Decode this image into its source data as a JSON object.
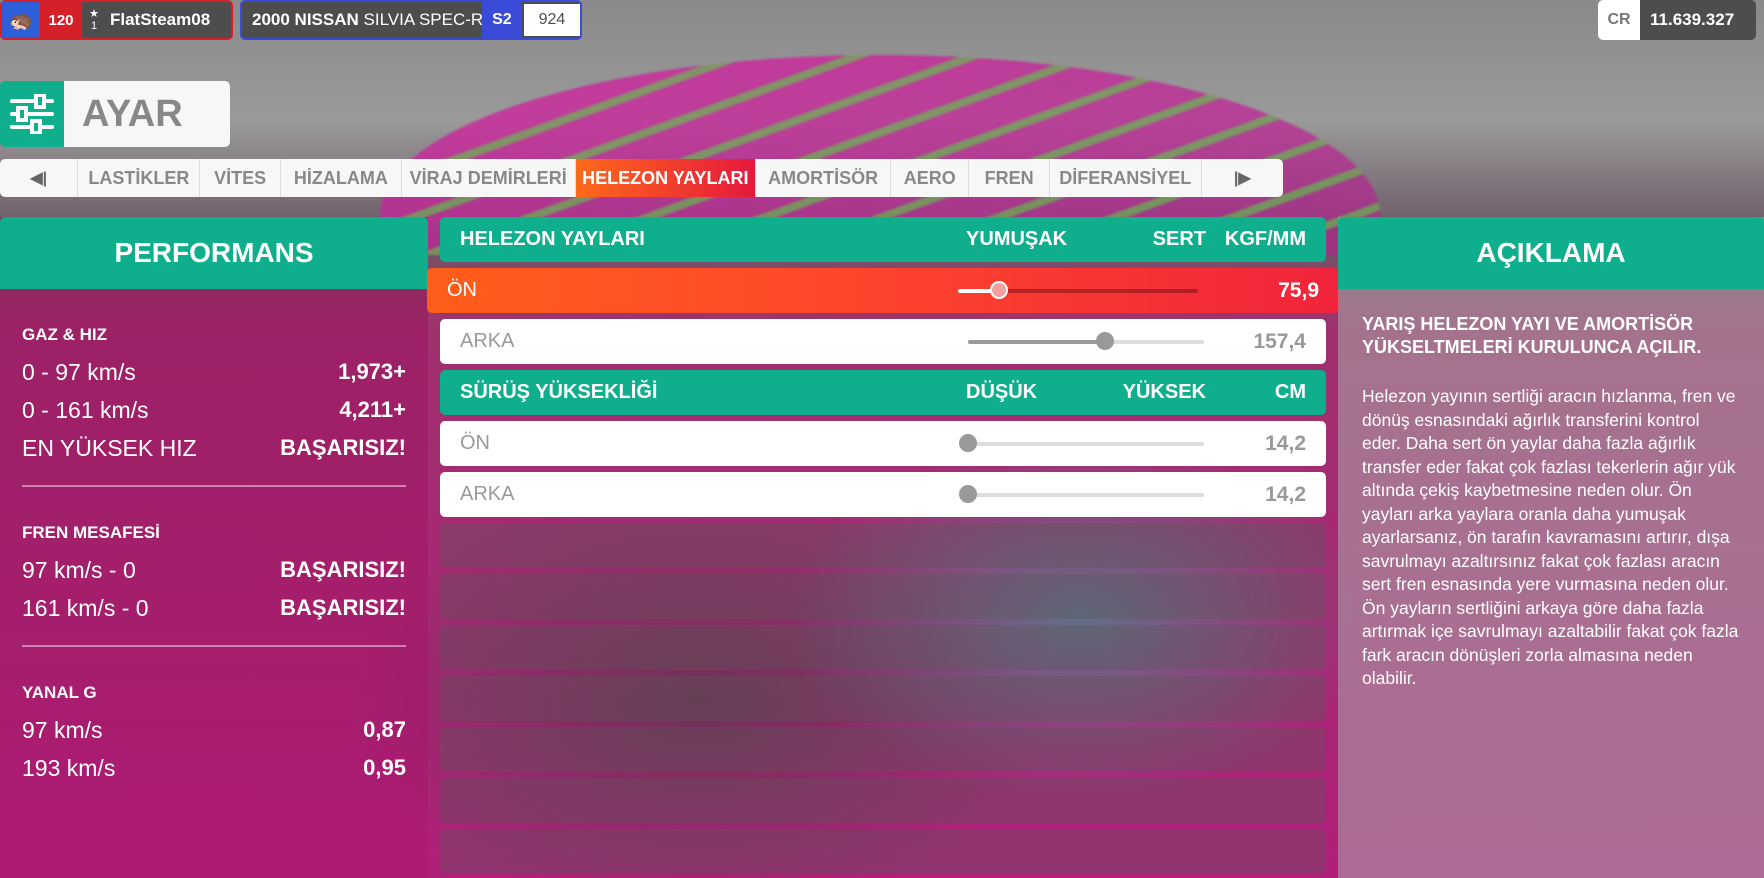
{
  "player": {
    "level": "120",
    "rank": "1",
    "gamertag": "FlatSteam08"
  },
  "car": {
    "name_bold": "2000 NISSAN",
    "name_rest": "SILVIA SPEC-R",
    "class": "S2",
    "pi": "924"
  },
  "credits": {
    "label": "CR",
    "amount": "11.639.327"
  },
  "page_title": "AYAR",
  "tabs": {
    "prev_icon": "◀|",
    "next_icon": "|▶",
    "items": [
      "LASTİKLER",
      "VİTES",
      "HİZALAMA",
      "VİRAJ DEMİRLERİ",
      "HELEZON YAYLARI",
      "AMORTİSÖR",
      "AERO",
      "FREN",
      "DİFERANSİYEL"
    ],
    "active": "HELEZON YAYLARI"
  },
  "performance": {
    "header": "PERFORMANS",
    "sections": [
      {
        "title": "GAZ & HIZ",
        "rows": [
          {
            "label": "0 - 97 km/s",
            "value": "1,973+"
          },
          {
            "label": "0 - 161 km/s",
            "value": "4,211+"
          },
          {
            "label": "EN YÜKSEK HIZ",
            "value": "BAŞARISIZ!"
          }
        ]
      },
      {
        "title": "FREN MESAFESİ",
        "rows": [
          {
            "label": "97 km/s - 0",
            "value": "BAŞARISIZ!"
          },
          {
            "label": "161 km/s - 0",
            "value": "BAŞARISIZ!"
          }
        ]
      },
      {
        "title": "YANAL G",
        "rows": [
          {
            "label": "97 km/s",
            "value": "0,87"
          },
          {
            "label": "193 km/s",
            "value": "0,95"
          }
        ]
      }
    ]
  },
  "springs": {
    "title": "HELEZON YAYLARI",
    "low": "YUMUŞAK",
    "high": "SERT",
    "unit": "KGF/MM",
    "rows": [
      {
        "label": "ÖN",
        "value": "75,9",
        "fraction": 0.17
      },
      {
        "label": "ARKA",
        "value": "157,4",
        "fraction": 0.58
      }
    ]
  },
  "ride_height": {
    "title": "SÜRÜŞ YÜKSEKLİĞİ",
    "low": "DÜŞÜK",
    "high": "YÜKSEK",
    "unit": "CM",
    "rows": [
      {
        "label": "ÖN",
        "value": "14,2",
        "fraction": 0.0
      },
      {
        "label": "ARKA",
        "value": "14,2",
        "fraction": 0.0
      }
    ]
  },
  "description": {
    "header": "AÇIKLAMA",
    "subtitle": "YARIŞ HELEZON YAYI VE AMORTİSÖR YÜKSELTMELERİ KURULUNCA AÇILIR.",
    "body": "Helezon yayının sertliği aracın hızlanma, fren ve dönüş esnasındaki ağırlık transferini kontrol eder. Daha sert ön yaylar daha fazla ağırlık transfer eder fakat çok fazlası tekerlerin ağır yük altında çekiş kaybetmesine neden olur. Ön yayları arka yaylara oranla daha yumuşak ayarlarsanız, ön tarafın kavramasını artırır, dışa savrulmayı azaltırsınız fakat çok fazlası aracın sert fren esnasında yere vurmasına neden olur. Ön yayların sertliğini arkaya göre daha fazla artırmak içe savrulmayı azaltabilir fakat çok fazla fark aracın dönüşleri zorla almasına neden olabilir."
  },
  "colors": {
    "accent": "#0fae8c",
    "active_tab": "#ff6a1a",
    "class_blue": "#3a4bd8",
    "player_red": "#d5202a"
  },
  "icons": {
    "avatar": "porcupine-avatar-icon",
    "rank": "star-icon",
    "title": "sliders-icon"
  }
}
